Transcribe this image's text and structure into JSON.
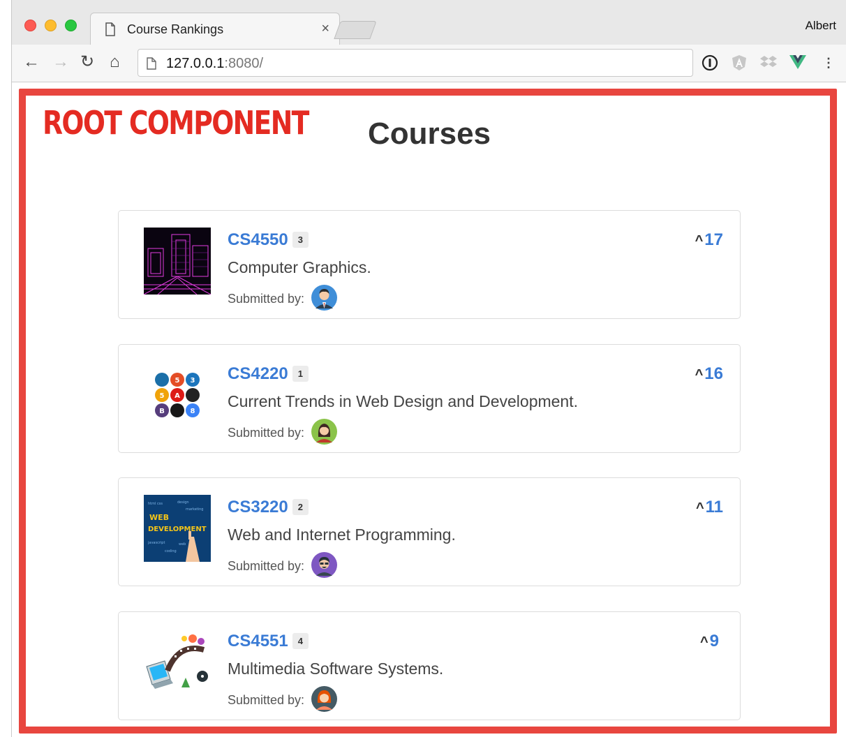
{
  "browser": {
    "tab_title": "Course Rankings",
    "tab_close": "×",
    "profile_name": "Albert",
    "url_host": "127.0.0.1",
    "url_rest": ":8080/",
    "nav_icons": [
      "back-arrow-icon",
      "forward-arrow-icon",
      "reload-icon",
      "home-icon"
    ],
    "extension_icons": [
      "1password-icon",
      "angular-icon",
      "dropbox-icon",
      "vue-devtools-icon",
      "menu-kebab-icon"
    ]
  },
  "annotation": {
    "label": "ROOT COMPONENT",
    "color": "#e8463f"
  },
  "page": {
    "title": "Courses"
  },
  "courses": [
    {
      "code": "CS4550",
      "rank": "3",
      "description": "Computer Graphics.",
      "submitted_label": "Submitted by:",
      "votes": "17",
      "thumbnail": "wireframe-city-image",
      "avatar": "man-suit-avatar"
    },
    {
      "code": "CS4220",
      "rank": "1",
      "description": "Current Trends in Web Design and Development.",
      "submitted_label": "Submitted by:",
      "votes": "16",
      "thumbnail": "web-technology-logos-image",
      "avatar": "woman-avatar"
    },
    {
      "code": "CS3220",
      "rank": "2",
      "description": "Web and Internet Programming.",
      "submitted_label": "Submitted by:",
      "votes": "11",
      "thumbnail": "web-development-word-cloud-image",
      "avatar": "man-glasses-avatar"
    },
    {
      "code": "CS4551",
      "rank": "4",
      "description": "Multimedia Software Systems.",
      "submitted_label": "Submitted by:",
      "votes": "9",
      "thumbnail": "multimedia-laptop-image",
      "avatar": "woman-redhair-avatar"
    }
  ],
  "colors": {
    "link": "#3a7bd5",
    "title": "#333333",
    "annotation_red": "#e42b22"
  }
}
